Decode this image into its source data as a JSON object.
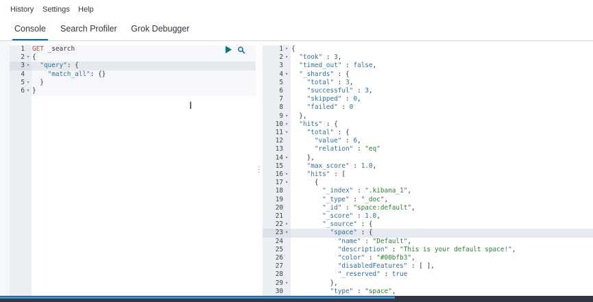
{
  "menu": {
    "history": "History",
    "settings": "Settings",
    "help": "Help"
  },
  "tabs": {
    "console": "Console",
    "search_profiler": "Search Profiler",
    "grok_debugger": "Grok Debugger"
  },
  "request_editor": {
    "line_numbers": [
      "1",
      "2",
      "3",
      "4",
      "5",
      "6"
    ],
    "lines": [
      [
        {
          "c": "method",
          "t": "GET"
        },
        {
          "c": "url",
          "t": " _search"
        }
      ],
      [
        {
          "c": "p",
          "t": "{"
        }
      ],
      [
        {
          "c": "p",
          "t": "  "
        },
        {
          "c": "key",
          "t": "\"query\""
        },
        {
          "c": "p",
          "t": ": {"
        }
      ],
      [
        {
          "c": "p",
          "t": "    "
        },
        {
          "c": "key",
          "t": "\"match_all\""
        },
        {
          "c": "p",
          "t": ": {}"
        }
      ],
      [
        {
          "c": "p",
          "t": "  }"
        }
      ],
      [
        {
          "c": "p",
          "t": "}"
        }
      ]
    ],
    "run_icon": "play-icon",
    "settings_icon": "wrench-icon"
  },
  "response_viewer": {
    "line_numbers": [
      "1",
      "2",
      "3",
      "4",
      "5",
      "6",
      "7",
      "8",
      "9",
      "10",
      "11",
      "12",
      "13",
      "14",
      "15",
      "16",
      "17",
      "18",
      "19",
      "20",
      "21",
      "22",
      "23",
      "24",
      "25",
      "26",
      "27",
      "28",
      "29",
      "30"
    ],
    "lines": [
      [
        {
          "c": "p",
          "t": "{"
        }
      ],
      [
        {
          "c": "p",
          "t": "  "
        },
        {
          "c": "key",
          "t": "\"took\""
        },
        {
          "c": "p",
          "t": " : "
        },
        {
          "c": "num",
          "t": "3"
        },
        {
          "c": "p",
          "t": ","
        }
      ],
      [
        {
          "c": "p",
          "t": "  "
        },
        {
          "c": "key",
          "t": "\"timed_out\""
        },
        {
          "c": "p",
          "t": " : "
        },
        {
          "c": "bool",
          "t": "false"
        },
        {
          "c": "p",
          "t": ","
        }
      ],
      [
        {
          "c": "p",
          "t": "  "
        },
        {
          "c": "key",
          "t": "\"_shards\""
        },
        {
          "c": "p",
          "t": " : {"
        }
      ],
      [
        {
          "c": "p",
          "t": "    "
        },
        {
          "c": "key",
          "t": "\"total\""
        },
        {
          "c": "p",
          "t": " : "
        },
        {
          "c": "num",
          "t": "3"
        },
        {
          "c": "p",
          "t": ","
        }
      ],
      [
        {
          "c": "p",
          "t": "    "
        },
        {
          "c": "key",
          "t": "\"successful\""
        },
        {
          "c": "p",
          "t": " : "
        },
        {
          "c": "num",
          "t": "3"
        },
        {
          "c": "p",
          "t": ","
        }
      ],
      [
        {
          "c": "p",
          "t": "    "
        },
        {
          "c": "key",
          "t": "\"skipped\""
        },
        {
          "c": "p",
          "t": " : "
        },
        {
          "c": "num",
          "t": "0"
        },
        {
          "c": "p",
          "t": ","
        }
      ],
      [
        {
          "c": "p",
          "t": "    "
        },
        {
          "c": "key",
          "t": "\"failed\""
        },
        {
          "c": "p",
          "t": " : "
        },
        {
          "c": "num",
          "t": "0"
        }
      ],
      [
        {
          "c": "p",
          "t": "  },"
        }
      ],
      [
        {
          "c": "p",
          "t": "  "
        },
        {
          "c": "key",
          "t": "\"hits\""
        },
        {
          "c": "p",
          "t": " : {"
        }
      ],
      [
        {
          "c": "p",
          "t": "    "
        },
        {
          "c": "key",
          "t": "\"total\""
        },
        {
          "c": "p",
          "t": " : {"
        }
      ],
      [
        {
          "c": "p",
          "t": "      "
        },
        {
          "c": "key",
          "t": "\"value\""
        },
        {
          "c": "p",
          "t": " : "
        },
        {
          "c": "num",
          "t": "6"
        },
        {
          "c": "p",
          "t": ","
        }
      ],
      [
        {
          "c": "p",
          "t": "      "
        },
        {
          "c": "key",
          "t": "\"relation\""
        },
        {
          "c": "p",
          "t": " : "
        },
        {
          "c": "str",
          "t": "\"eq\""
        }
      ],
      [
        {
          "c": "p",
          "t": "    },"
        }
      ],
      [
        {
          "c": "p",
          "t": "    "
        },
        {
          "c": "key",
          "t": "\"max_score\""
        },
        {
          "c": "p",
          "t": " : "
        },
        {
          "c": "num",
          "t": "1.0"
        },
        {
          "c": "p",
          "t": ","
        }
      ],
      [
        {
          "c": "p",
          "t": "    "
        },
        {
          "c": "key",
          "t": "\"hits\""
        },
        {
          "c": "p",
          "t": " : ["
        }
      ],
      [
        {
          "c": "p",
          "t": "      {"
        }
      ],
      [
        {
          "c": "p",
          "t": "        "
        },
        {
          "c": "key",
          "t": "\"_index\""
        },
        {
          "c": "p",
          "t": " : "
        },
        {
          "c": "str",
          "t": "\".kibana_1\""
        },
        {
          "c": "p",
          "t": ","
        }
      ],
      [
        {
          "c": "p",
          "t": "        "
        },
        {
          "c": "key",
          "t": "\"_type\""
        },
        {
          "c": "p",
          "t": " : "
        },
        {
          "c": "str",
          "t": "\"_doc\""
        },
        {
          "c": "p",
          "t": ","
        }
      ],
      [
        {
          "c": "p",
          "t": "        "
        },
        {
          "c": "key",
          "t": "\"_id\""
        },
        {
          "c": "p",
          "t": " : "
        },
        {
          "c": "str",
          "t": "\"space:default\""
        },
        {
          "c": "p",
          "t": ","
        }
      ],
      [
        {
          "c": "p",
          "t": "        "
        },
        {
          "c": "key",
          "t": "\"_score\""
        },
        {
          "c": "p",
          "t": " : "
        },
        {
          "c": "num",
          "t": "1.0"
        },
        {
          "c": "p",
          "t": ","
        }
      ],
      [
        {
          "c": "p",
          "t": "        "
        },
        {
          "c": "key",
          "t": "\"_source\""
        },
        {
          "c": "p",
          "t": " : {"
        }
      ],
      [
        {
          "c": "p",
          "t": "          "
        },
        {
          "c": "key",
          "t": "\"space\""
        },
        {
          "c": "p",
          "t": " : {"
        }
      ],
      [
        {
          "c": "p",
          "t": "            "
        },
        {
          "c": "key",
          "t": "\"name\""
        },
        {
          "c": "p",
          "t": " : "
        },
        {
          "c": "str",
          "t": "\"Default\""
        },
        {
          "c": "p",
          "t": ","
        }
      ],
      [
        {
          "c": "p",
          "t": "            "
        },
        {
          "c": "key",
          "t": "\"description\""
        },
        {
          "c": "p",
          "t": " : "
        },
        {
          "c": "str",
          "t": "\"This is your default space!\""
        },
        {
          "c": "p",
          "t": ","
        }
      ],
      [
        {
          "c": "p",
          "t": "            "
        },
        {
          "c": "key",
          "t": "\"color\""
        },
        {
          "c": "p",
          "t": " : "
        },
        {
          "c": "str",
          "t": "\"#00bfb3\""
        },
        {
          "c": "p",
          "t": ","
        }
      ],
      [
        {
          "c": "p",
          "t": "            "
        },
        {
          "c": "key",
          "t": "\"disabledFeatures\""
        },
        {
          "c": "p",
          "t": " : [ ],"
        }
      ],
      [
        {
          "c": "p",
          "t": "            "
        },
        {
          "c": "key",
          "t": "\"_reserved\""
        },
        {
          "c": "p",
          "t": " : "
        },
        {
          "c": "bool",
          "t": "true"
        }
      ],
      [
        {
          "c": "p",
          "t": "          },"
        }
      ],
      [
        {
          "c": "p",
          "t": "          "
        },
        {
          "c": "key",
          "t": "\"type\""
        },
        {
          "c": "p",
          "t": " : "
        },
        {
          "c": "str",
          "t": "\"space\""
        },
        {
          "c": "p",
          "t": ","
        }
      ]
    ],
    "foldable": [
      1,
      2,
      4,
      9,
      10,
      11,
      14,
      16,
      17,
      22,
      23,
      29
    ]
  },
  "request_foldable": [
    2,
    3,
    5,
    6
  ],
  "colors": {
    "accent": "#006bb4",
    "progress": "#3a9ad9",
    "run_icon": "#017d73"
  }
}
